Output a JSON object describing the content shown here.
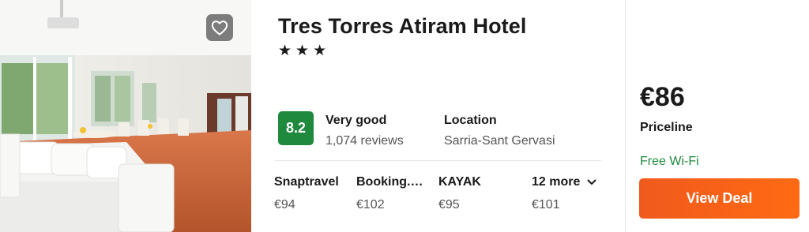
{
  "hotel": {
    "name": "Tres Torres Atiram Hotel",
    "stars": "★★★",
    "star_count": 3
  },
  "rating": {
    "score": "8.2",
    "label": "Very good",
    "reviews": "1,074 reviews",
    "badge_color": "#1f8a3e"
  },
  "location": {
    "label": "Location",
    "value": "Sarria-Sant Gervasi"
  },
  "providers": [
    {
      "name": "Snaptravel",
      "price": "€94"
    },
    {
      "name": "Booking.com",
      "price": "€102"
    },
    {
      "name": "KAYAK",
      "price": "€95"
    }
  ],
  "more": {
    "label": "12 more",
    "price": "€101",
    "icon": "chevron-down-icon"
  },
  "deal": {
    "price": "€86",
    "site": "Priceline",
    "perk": "Free Wi-Fi",
    "button_label": "View Deal",
    "button_color": "#ff6a13",
    "perk_color": "#1f8a3e"
  },
  "photo": {
    "favorite_icon": "heart-icon"
  }
}
